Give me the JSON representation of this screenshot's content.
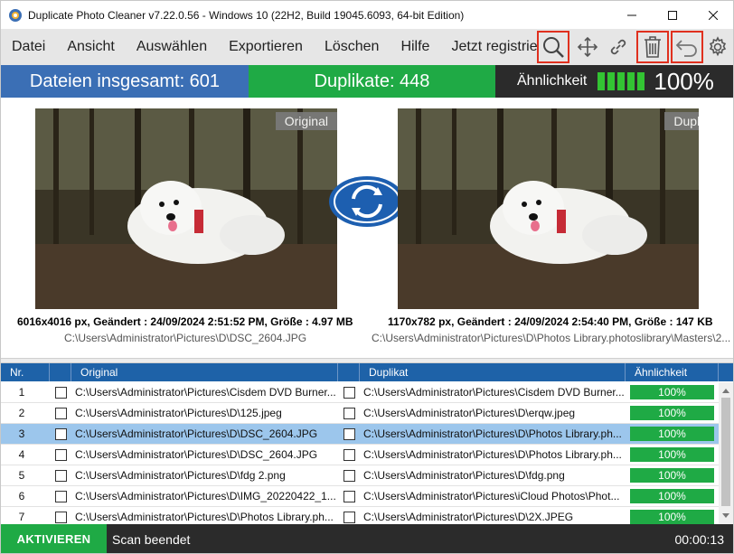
{
  "window": {
    "title": "Duplicate Photo Cleaner v7.22.0.56 - Windows 10 (22H2, Build 19045.6093, 64-bit Edition)"
  },
  "menu": [
    "Datei",
    "Ansicht",
    "Auswählen",
    "Exportieren",
    "Löschen",
    "Hilfe",
    "Jetzt registrieren"
  ],
  "toolbar": {
    "icons": [
      "search-icon",
      "move-icon",
      "link-icon",
      "trash-icon",
      "undo-icon",
      "gear-icon"
    ],
    "highlighted": [
      "search-icon",
      "trash-icon",
      "undo-icon"
    ],
    "highlight_color": "#e0301e"
  },
  "stats": {
    "total": "Dateien insgesamt: 601",
    "duplicates": "Duplikate: 448",
    "similarity_label": "Ähnlichkeit",
    "similarity_value": "100%",
    "similarity_level": 1.0
  },
  "preview": {
    "original_tag": "Original",
    "duplicate_tag": "Duplikat",
    "original_meta": "6016x4016 px, Geändert : 24/09/2024 2:51:52 PM, Größe : 4.97 MB",
    "original_path": "C:\\Users\\Administrator\\Pictures\\D\\DSC_2604.JPG",
    "duplicate_meta": "1170x782 px, Geändert : 24/09/2024 2:54:40 PM, Größe : 147 KB",
    "duplicate_path": "C:\\Users\\Administrator\\Pictures\\D\\Photos Library.photoslibrary\\Masters\\2..."
  },
  "table": {
    "headers": {
      "nr": "Nr.",
      "original": "Original",
      "duplicate": "Duplikat",
      "similarity": "Ähnlichkeit"
    },
    "rows": [
      {
        "nr": "1",
        "original": "C:\\Users\\Administrator\\Pictures\\Cisdem DVD Burner...",
        "duplicate": "C:\\Users\\Administrator\\Pictures\\Cisdem DVD Burner...",
        "similarity": "100%",
        "selected": false
      },
      {
        "nr": "2",
        "original": "C:\\Users\\Administrator\\Pictures\\D\\125.jpeg",
        "duplicate": "C:\\Users\\Administrator\\Pictures\\D\\erqw.jpeg",
        "similarity": "100%",
        "selected": false
      },
      {
        "nr": "3",
        "original": "C:\\Users\\Administrator\\Pictures\\D\\DSC_2604.JPG",
        "duplicate": "C:\\Users\\Administrator\\Pictures\\D\\Photos Library.ph...",
        "similarity": "100%",
        "selected": true
      },
      {
        "nr": "4",
        "original": "C:\\Users\\Administrator\\Pictures\\D\\DSC_2604.JPG",
        "duplicate": "C:\\Users\\Administrator\\Pictures\\D\\Photos Library.ph...",
        "similarity": "100%",
        "selected": false
      },
      {
        "nr": "5",
        "original": "C:\\Users\\Administrator\\Pictures\\D\\fdg 2.png",
        "duplicate": "C:\\Users\\Administrator\\Pictures\\D\\fdg.png",
        "similarity": "100%",
        "selected": false
      },
      {
        "nr": "6",
        "original": "C:\\Users\\Administrator\\Pictures\\D\\IMG_20220422_1...",
        "duplicate": "C:\\Users\\Administrator\\Pictures\\iCloud Photos\\Phot...",
        "similarity": "100%",
        "selected": false
      },
      {
        "nr": "7",
        "original": "C:\\Users\\Administrator\\Pictures\\D\\Photos Library.ph...",
        "duplicate": "C:\\Users\\Administrator\\Pictures\\D\\2X.JPEG",
        "similarity": "100%",
        "selected": false
      }
    ]
  },
  "status": {
    "activate_label": "AKTIVIEREN",
    "text": "Scan beendet",
    "timer": "00:00:13"
  },
  "colors": {
    "blue": "#3b6fb5",
    "green": "#1faa45",
    "dark": "#2b2b2b",
    "header_blue": "#1e62a8",
    "selected_row": "#9cc6ec"
  }
}
